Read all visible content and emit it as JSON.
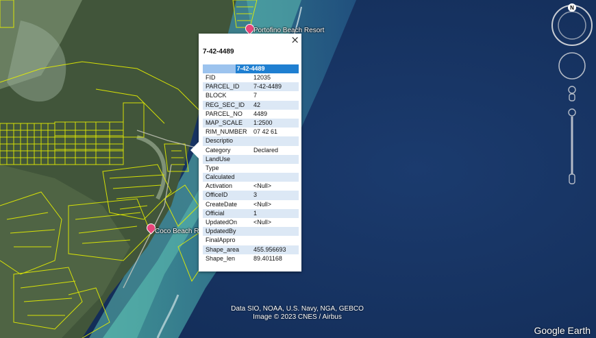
{
  "map": {
    "places": [
      {
        "id": "portofino",
        "label": "Portofino Beach Resort"
      },
      {
        "id": "coco",
        "label": "Coco Beach R"
      }
    ],
    "attribution_line1": "Data SIO, NOAA, U.S. Navy, NGA, GEBCO",
    "attribution_line2": "Image © 2023 CNES / Airbus",
    "logo": "Google Earth",
    "compass_north": "N",
    "colors": {
      "parcel": "#e6f000",
      "sea": "#173566",
      "reef": "#3d9c9c",
      "land": "#4b5e3a"
    }
  },
  "popup": {
    "title": "7-42-4489",
    "header": "7-42-4489",
    "close_icon": "×",
    "rows": [
      {
        "key": "FID",
        "value": "12035"
      },
      {
        "key": "PARCEL_ID",
        "value": "7-42-4489"
      },
      {
        "key": "BLOCK",
        "value": "7"
      },
      {
        "key": "REG_SEC_ID",
        "value": "42"
      },
      {
        "key": "PARCEL_NO",
        "value": "4489"
      },
      {
        "key": "MAP_SCALE",
        "value": "1:2500"
      },
      {
        "key": "RIM_NUMBER",
        "value": "07 42 61"
      },
      {
        "key": "Descriptio",
        "value": ""
      },
      {
        "key": "Category",
        "value": "Declared"
      },
      {
        "key": "LandUse",
        "value": ""
      },
      {
        "key": "Type",
        "value": ""
      },
      {
        "key": "Calculated",
        "value": ""
      },
      {
        "key": "Activation",
        "value": "<Null>"
      },
      {
        "key": "OfficeID",
        "value": "3"
      },
      {
        "key": "CreateDate",
        "value": "<Null>"
      },
      {
        "key": "Official",
        "value": "1"
      },
      {
        "key": "UpdatedOn",
        "value": "<Null>"
      },
      {
        "key": "UpdatedBy",
        "value": ""
      },
      {
        "key": "FinalAppro",
        "value": ""
      },
      {
        "key": "Shape_area",
        "value": "455.956693"
      },
      {
        "key": "Shape_len",
        "value": "89.401168"
      }
    ]
  }
}
